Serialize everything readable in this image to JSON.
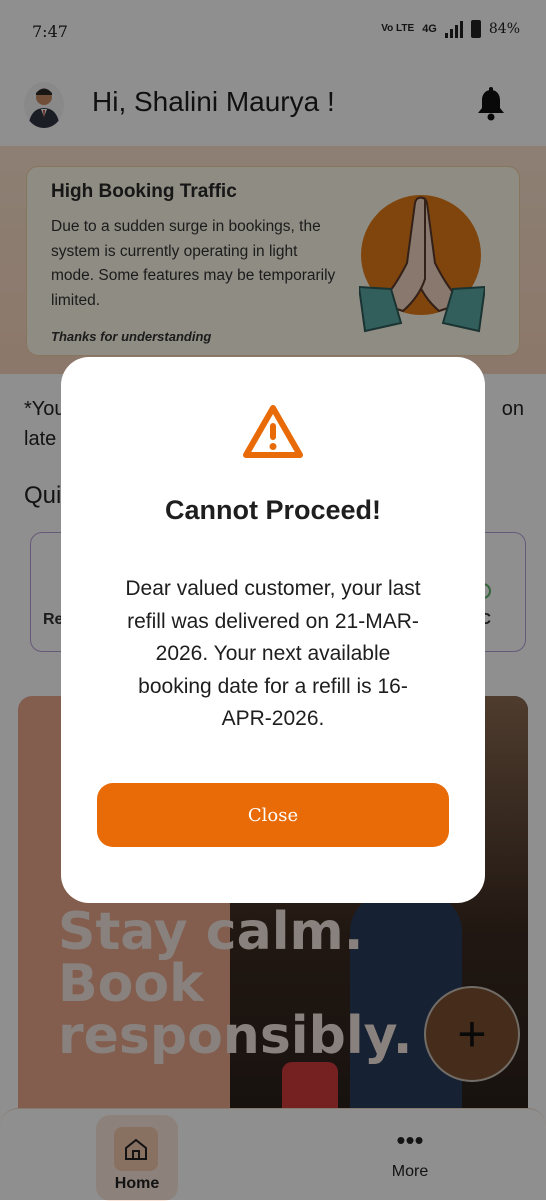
{
  "status_bar": {
    "time": "7:47",
    "network": "4G",
    "battery": "84%",
    "volte": "Vo LTE"
  },
  "header": {
    "greeting": "Hi, Shalini Maurya !"
  },
  "banner": {
    "title": "High Booking Traffic",
    "text": "Due to a sudden surge in bookings, the system is currently operating in light mode. Some features may be temporarily limited.",
    "thanks": "Thanks for understanding"
  },
  "background_page": {
    "note_left_line1": "*You",
    "note_right_line1": "on",
    "note_left_line2": "late",
    "quick_heading": "Qui",
    "quick_left_label": "Re",
    "quick_right_label": "C",
    "promo_line1": "Stay calm.",
    "promo_line2": "Book",
    "promo_line3": "responsibly."
  },
  "modal": {
    "title": "Cannot Proceed!",
    "message": "Dear valued customer, your last refill was delivered on 21-MAR-2026. Your next available booking date for a refill is 16-APR-2026.",
    "close_label": "Close"
  },
  "bottom_nav": {
    "home_label": "Home",
    "more_label": "More"
  },
  "colors": {
    "accent": "#e86b07",
    "warning": "#e86b07",
    "overlay": "rgba(0,0,0,0.44)"
  },
  "icons": {
    "avatar": "avatar-icon",
    "bell": "bell-icon",
    "namaste": "namaste-icon",
    "warning": "warning-icon",
    "home": "home-icon",
    "more": "more-icon",
    "fab": "plus-icon"
  }
}
